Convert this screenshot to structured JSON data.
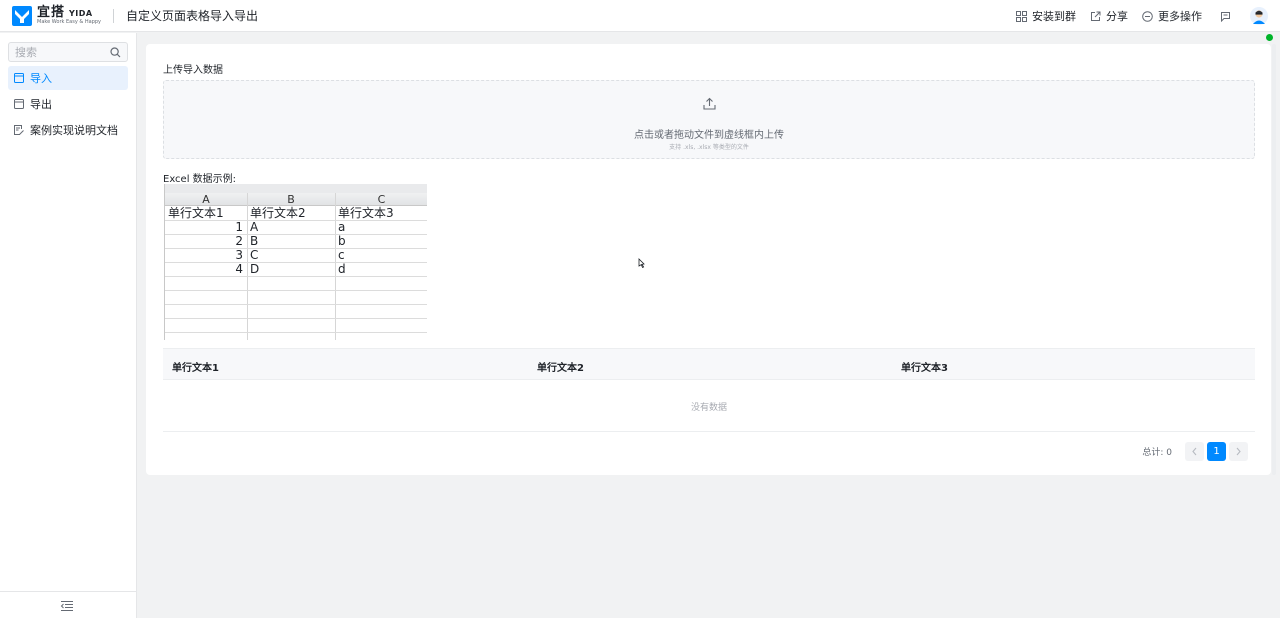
{
  "header": {
    "logo_cn": "宜搭",
    "logo_en": "YIDA",
    "logo_tagline": "Make Work Easy & Happy",
    "app_title": "自定义页面表格导入导出",
    "actions": [
      "安装到群",
      "分享",
      "更多操作"
    ]
  },
  "sidebar": {
    "search_placeholder": "搜索",
    "items": [
      {
        "label": "导入",
        "active": true
      },
      {
        "label": "导出",
        "active": false
      },
      {
        "label": "案例实现说明文档",
        "active": false
      }
    ]
  },
  "main": {
    "upload_label": "上传导入数据",
    "upload_main_text": "点击或者拖动文件到虚线框内上传",
    "upload_hint": "支持 .xls, .xlsx 等类型的文件",
    "excel_label": "Excel 数据示例:",
    "excel": {
      "columns": [
        "A",
        "B",
        "C"
      ],
      "header_row": [
        "单行文本1",
        "单行文本2",
        "单行文本3"
      ],
      "rows": [
        [
          "1",
          "A",
          "a"
        ],
        [
          "2",
          "B",
          "b"
        ],
        [
          "3",
          "C",
          "c"
        ],
        [
          "4",
          "D",
          "d"
        ]
      ]
    },
    "table": {
      "columns": [
        "单行文本1",
        "单行文本2",
        "单行文本3"
      ],
      "empty_text": "没有数据"
    },
    "pagination": {
      "total_text": "总计: 0",
      "current_page": "1"
    }
  },
  "colors": {
    "accent": "#0089ff",
    "active_bg": "#e8f1fd",
    "status_online": "#00b42a"
  }
}
